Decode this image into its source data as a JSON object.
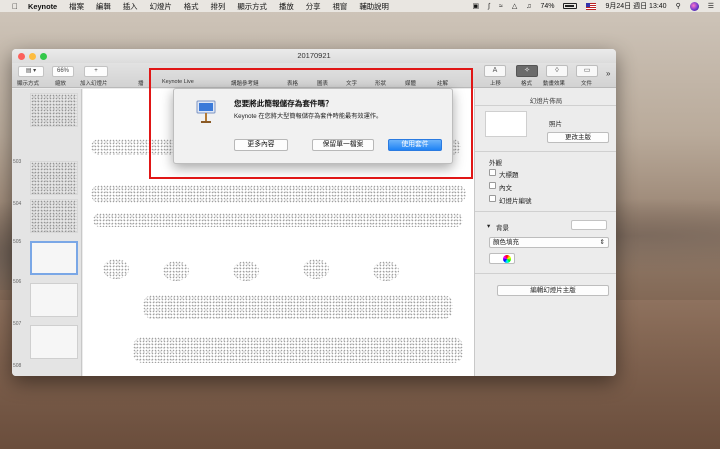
{
  "menubar": {
    "app_name": "Keynote",
    "items": [
      "檔案",
      "編輯",
      "插入",
      "幻燈片",
      "格式",
      "排列",
      "顯示方式",
      "播放",
      "分享",
      "視窗",
      "輔助說明"
    ],
    "battery": "74%",
    "datetime": "9月24日 週日 13:40"
  },
  "window": {
    "title": "20170921",
    "toolbar": {
      "view_label": "顯示方式",
      "zoom_value": "66%",
      "zoom_label": "縮放",
      "add_slide_label": "加入幻燈片",
      "play_label": "播",
      "keynote_live_label": "Keynote Live",
      "presenter_notes_label": "講題參考鏈",
      "table_label": "表格",
      "chart_label": "圖表",
      "text_label": "文字",
      "shape_label": "形狀",
      "media_label": "媒體",
      "comment_label": "註解",
      "animate_label": "上移",
      "format_label": "格式",
      "animation_label": "動畫效果",
      "document_label": "文件"
    },
    "navigator": {
      "slide_numbers": [
        "503",
        "504",
        "505",
        "506",
        "507",
        "508"
      ]
    },
    "inspector": {
      "title": "幻燈片佈局",
      "slide_label": "照片",
      "change_master_button": "更改主版",
      "appearance_heading": "外觀",
      "checkboxes": [
        "大標題",
        "內文",
        "幻燈片編號"
      ],
      "background_label": "背景",
      "fill_type": "顏色填充",
      "edit_master_button": "編輯幻燈片主版"
    }
  },
  "dialog": {
    "title": "您要將此簡報儲存為套件嗎？",
    "message": "Keynote 在您將大型簡報儲存為套件時能最有效運作。",
    "more_info_button": "更多內容",
    "keep_single_file_button": "保留單一檔案",
    "use_package_button": "使用套件"
  },
  "colors": {
    "annotation_box": "#e01616",
    "primary_button": "#1f83f5"
  }
}
